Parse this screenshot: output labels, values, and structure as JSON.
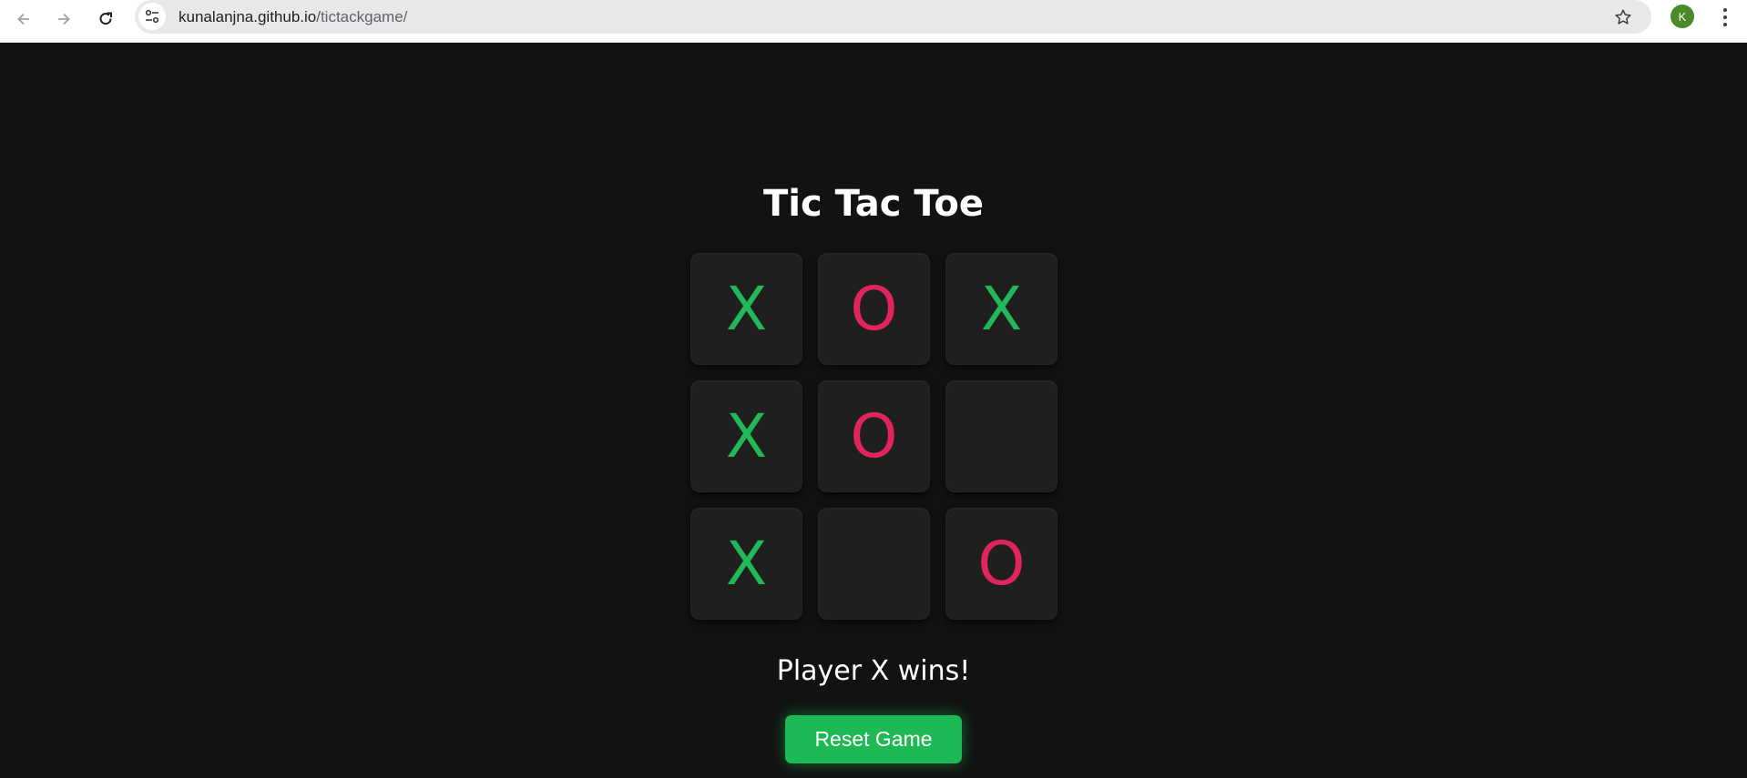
{
  "browser": {
    "url_host": "kunalanjna.github.io",
    "url_path": "/tictackgame/",
    "avatar_letter": "K",
    "back_icon": "arrow-left",
    "forward_icon": "arrow-right",
    "reload_icon": "reload",
    "site_info_icon": "tune-sliders",
    "bookmark_icon": "star-outline",
    "menu_icon": "three-dots-vertical"
  },
  "game": {
    "title": "Tic Tac Toe",
    "board": [
      [
        "X",
        "O",
        "X"
      ],
      [
        "X",
        "O",
        ""
      ],
      [
        "X",
        "",
        "O"
      ]
    ],
    "status": "Player X wins!",
    "reset_label": "Reset Game"
  },
  "colors": {
    "background": "#121212",
    "cell": "#1f1f1f",
    "x_color": "#22b85a",
    "o_color": "#e0245e",
    "button": "#1db954"
  }
}
